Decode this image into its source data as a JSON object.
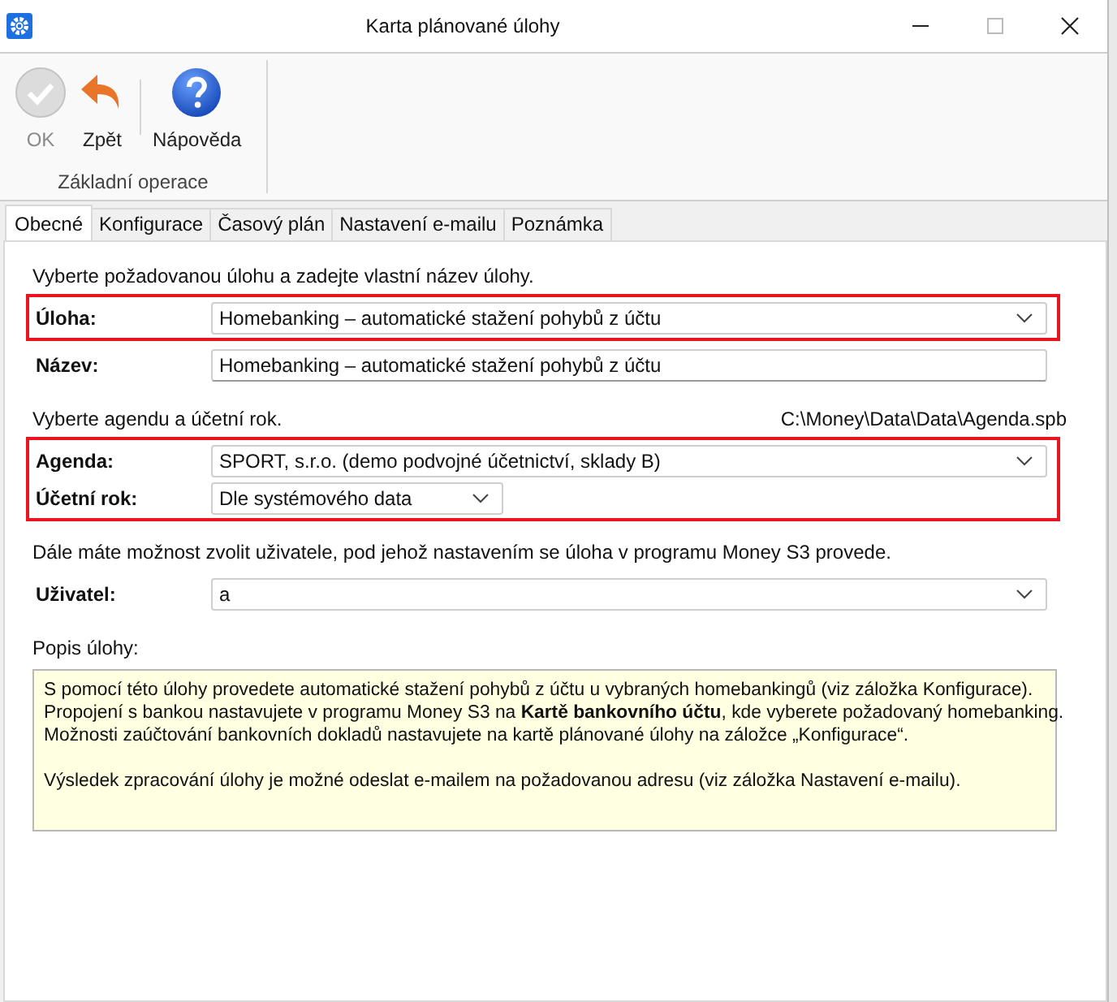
{
  "window": {
    "title": "Karta plánované úlohy"
  },
  "ribbon": {
    "groups": [
      {
        "label": "Základní operace",
        "buttons": [
          {
            "kind": "ok",
            "label": "OK",
            "disabled": true,
            "separator_after": false
          },
          {
            "kind": "back",
            "label": "Zpět",
            "disabled": false,
            "separator_after": true
          },
          {
            "kind": "help",
            "label": "Nápověda",
            "disabled": false,
            "separator_after": false
          }
        ]
      }
    ]
  },
  "tabs": [
    {
      "label": "Obecné",
      "selected": true
    },
    {
      "label": "Konfigurace",
      "selected": false
    },
    {
      "label": "Časový plán",
      "selected": false
    },
    {
      "label": "Nastavení e-mailu",
      "selected": false
    },
    {
      "label": "Poznámka",
      "selected": false
    }
  ],
  "sections": [
    {
      "hint": "Vyberte požadovanou úlohu a zadejte vlastní název úlohy.",
      "groups": [
        {
          "highlighted": true,
          "fields": [
            {
              "label": "Úloha:",
              "kind": "combo",
              "value": "Homebanking – automatické stažení pohybů z účtu"
            }
          ]
        },
        {
          "highlighted": false,
          "fields": [
            {
              "label": "Název:",
              "kind": "text",
              "value": "Homebanking – automatické stažení pohybů z účtu"
            }
          ]
        }
      ]
    },
    {
      "hint": "Vyberte agendu a účetní rok.",
      "path": "C:\\Money\\Data\\Data\\Agenda.spb",
      "groups": [
        {
          "highlighted": true,
          "fields": [
            {
              "label": "Agenda:",
              "kind": "combo",
              "value": "SPORT, s.r.o. (demo podvojné účetnictví, sklady B)"
            },
            {
              "label": "Účetní rok:",
              "kind": "short_combo",
              "value": "Dle systémového data"
            }
          ]
        }
      ]
    },
    {
      "hint": "Dále máte možnost zvolit uživatele, pod jehož nastavením se úloha v programu Money S3 provede.",
      "groups": [
        {
          "highlighted": false,
          "fields": [
            {
              "label": "Uživatel:",
              "kind": "combo",
              "value": "a"
            }
          ]
        }
      ]
    }
  ],
  "description": {
    "label": "Popis úlohy:",
    "paragraphs": [
      {
        "lines": [
          "S pomocí této úlohy provedete automatické stažení pohybů z účtu u vybraných homebankingů (viz záložka Konfigurace).",
          "Propojení s bankou nastavujete v programu Money S3 na **Kartě bankovního účtu**, kde vyberete požadovaný homebanking.",
          "Možnosti zaúčtování bankovních dokladů nastavujete na kartě plánované úlohy na záložce „Konfigurace“."
        ]
      },
      {
        "lines": [
          "Výsledek zpracování úlohy je možné odeslat e-mailem na požadovanou adresu (viz záložka Nastavení e-mailu)."
        ]
      }
    ]
  }
}
